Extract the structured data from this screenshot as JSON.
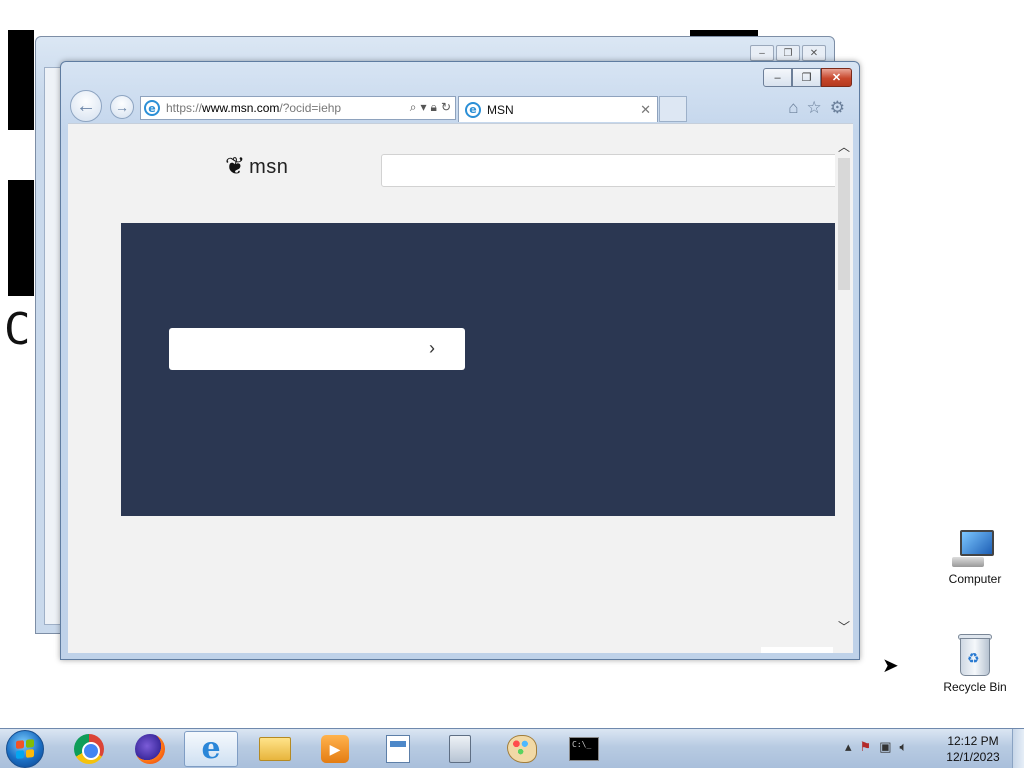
{
  "desktop": {
    "bg_fragment_text": "C",
    "icons": [
      {
        "label": "Computer",
        "icon": "computer-icon"
      },
      {
        "label": "Recycle Bin",
        "icon": "recycle-bin-icon"
      }
    ]
  },
  "browser": {
    "address": {
      "scheme": "https://",
      "host": "www.msn.com",
      "path": "/?ocid=iehp"
    },
    "tab": {
      "title": "MSN"
    },
    "page": {
      "logo_text": "msn",
      "search_value": "",
      "hero_input_value": ""
    }
  },
  "taskbar": {
    "apps": [
      {
        "name": "Google Chrome",
        "icon": "chrome-icon"
      },
      {
        "name": "Firefox",
        "icon": "firefox-icon"
      },
      {
        "name": "Internet Explorer",
        "icon": "internet-explorer-icon",
        "active": true
      },
      {
        "name": "Windows Explorer",
        "icon": "folder-icon"
      },
      {
        "name": "Media Player",
        "icon": "media-player-icon"
      },
      {
        "name": "WordPad",
        "icon": "wordpad-icon"
      },
      {
        "name": "Calculator",
        "icon": "calculator-icon"
      },
      {
        "name": "Paint",
        "icon": "paint-icon"
      },
      {
        "name": "Command Prompt",
        "icon": "command-prompt-icon"
      }
    ],
    "clock": {
      "time": "12:12 PM",
      "date": "12/1/2023"
    }
  },
  "colors": {
    "hero_background": "#2b3752",
    "page_background": "#f2f2f2",
    "ie_blue": "#2b8fd6"
  }
}
